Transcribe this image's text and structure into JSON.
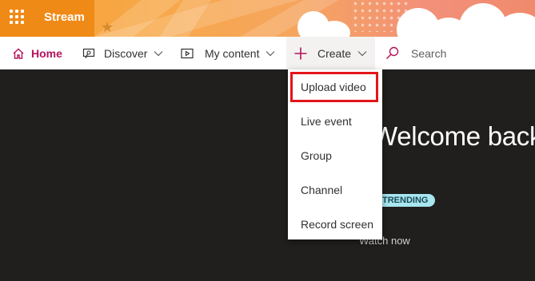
{
  "app": {
    "name": "Stream"
  },
  "nav": {
    "home": "Home",
    "discover": "Discover",
    "my_content": "My content",
    "create": "Create",
    "search_placeholder": "Search"
  },
  "create_menu": {
    "items": [
      "Upload video",
      "Live event",
      "Group",
      "Channel",
      "Record screen"
    ],
    "highlighted": "Upload video"
  },
  "hero": {
    "welcome": "Welcome back,",
    "badge": "TRENDING",
    "watch_now": "Watch now"
  },
  "colors": {
    "accent": "#b4135c",
    "banner_orange": "#f08a16",
    "highlight_box": "#e3151a",
    "hero_background": "#201f1e",
    "badge": "#a8e6f0"
  },
  "icons": [
    "app-launcher-icon",
    "home-icon",
    "discover-icon",
    "my-content-icon",
    "plus-icon",
    "chevron-down-icon",
    "search-icon"
  ]
}
